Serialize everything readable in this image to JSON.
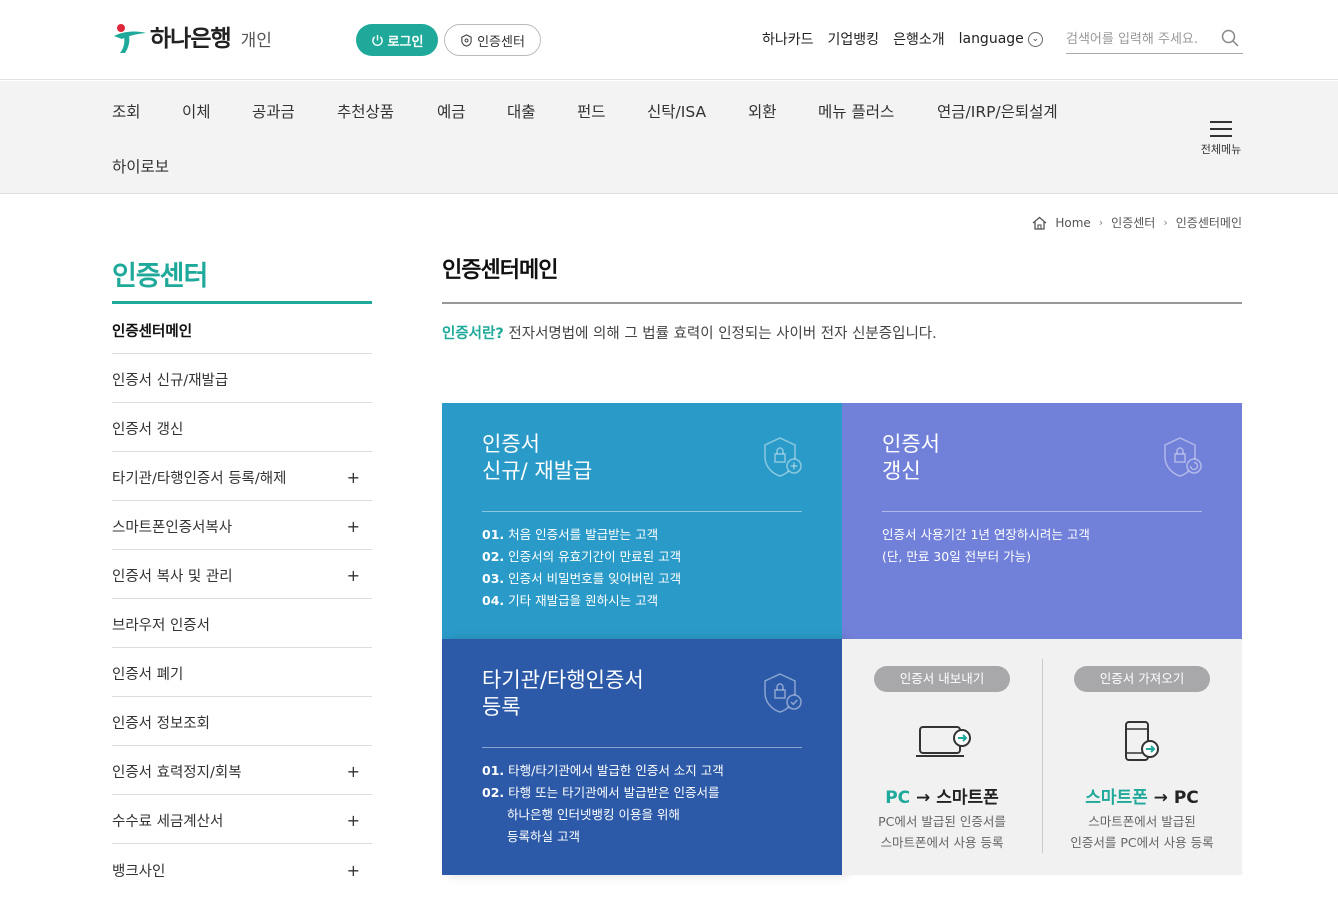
{
  "header": {
    "logo_text": "하나은행",
    "logo_sub": "개인",
    "login_label": "로그인",
    "cert_center_label": "인증센터",
    "top_links": [
      "하나카드",
      "기업뱅킹",
      "은행소개"
    ],
    "language_label": "language",
    "search_placeholder": "검색어를 입력해 주세요."
  },
  "gnb": {
    "items": [
      "조회",
      "이체",
      "공과금",
      "추천상품",
      "예금",
      "대출",
      "펀드",
      "신탁/ISA",
      "외환",
      "메뉴 플러스",
      "연금/IRP/은퇴설계",
      "하이로보"
    ],
    "all_menu_label": "전체메뉴"
  },
  "breadcrumb": [
    "Home",
    "인증센터",
    "인증센터메인"
  ],
  "lnb": {
    "title": "인증센터",
    "items": [
      {
        "label": "인증센터메인",
        "plus": ""
      },
      {
        "label": "인증서 신규/재발급",
        "plus": ""
      },
      {
        "label": "인증서 갱신",
        "plus": ""
      },
      {
        "label": "타기관/타행인증서 등록/해제",
        "plus": "+"
      },
      {
        "label": "스마트폰인증서복사",
        "plus": "+"
      },
      {
        "label": "인증서 복사 및 관리",
        "plus": "+"
      },
      {
        "label": "브라우저 인증서",
        "plus": ""
      },
      {
        "label": "인증서 폐기",
        "plus": ""
      },
      {
        "label": "인증서 정보조회",
        "plus": ""
      },
      {
        "label": "인증서 효력정지/회복",
        "plus": "+"
      },
      {
        "label": "수수료 세금계산서",
        "plus": "+"
      },
      {
        "label": "뱅크사인",
        "plus": "+"
      }
    ]
  },
  "main": {
    "title": "인증센터메인",
    "intro_highlight": "인증서란?",
    "intro_text": " 전자서명법에 의해 그 법률 효력이 인정되는 사이버 전자 신분증입니다.",
    "card1": {
      "title": "인증서\n신규/ 재발급",
      "items": [
        {
          "num": "01.",
          "text": "처음 인증서를 발급받는 고객"
        },
        {
          "num": "02.",
          "text": "인증서의 유효기간이 만료된 고객"
        },
        {
          "num": "03.",
          "text": "인증서 비밀번호를 잊어버린 고객"
        },
        {
          "num": "04.",
          "text": "기타 재발급을 원하시는 고객"
        }
      ]
    },
    "card2": {
      "title": "인증서\n갱신",
      "line1": "인증서 사용기간 1년 연장하시려는 고객",
      "line2": "(단, 만료 30일 전부터 가능)"
    },
    "card3": {
      "title": "타기관/타행인증서\n등록",
      "item1_num": "01.",
      "item1_text": "타행/타기관에서 발급한 인증서 소지 고객",
      "item2_num": "02.",
      "item2_text": "타행 또는 타기관에서 발급받은 인증서를",
      "item2_line2": "하나은행 인터넷뱅킹 이용을 위해",
      "item2_line3": "등록하실 고객"
    },
    "card4": {
      "export": {
        "pill": "인증서 내보내기",
        "title_hl": "PC",
        "title_rest": " → 스마트폰",
        "desc": "PC에서 발급된 인증서를\n스마트폰에서 사용 등록"
      },
      "import": {
        "pill": "인증서 가져오기",
        "title_hl": "스마트폰",
        "title_rest": " → PC",
        "desc": "스마트폰에서 발급된\n인증서를 PC에서 사용 등록"
      }
    }
  },
  "colors": {
    "brand": "#1fa99a",
    "card1": "#2a9bc8",
    "card2": "#7180d8",
    "card3": "#2c5aa8",
    "card4": "#f1f1f2"
  }
}
